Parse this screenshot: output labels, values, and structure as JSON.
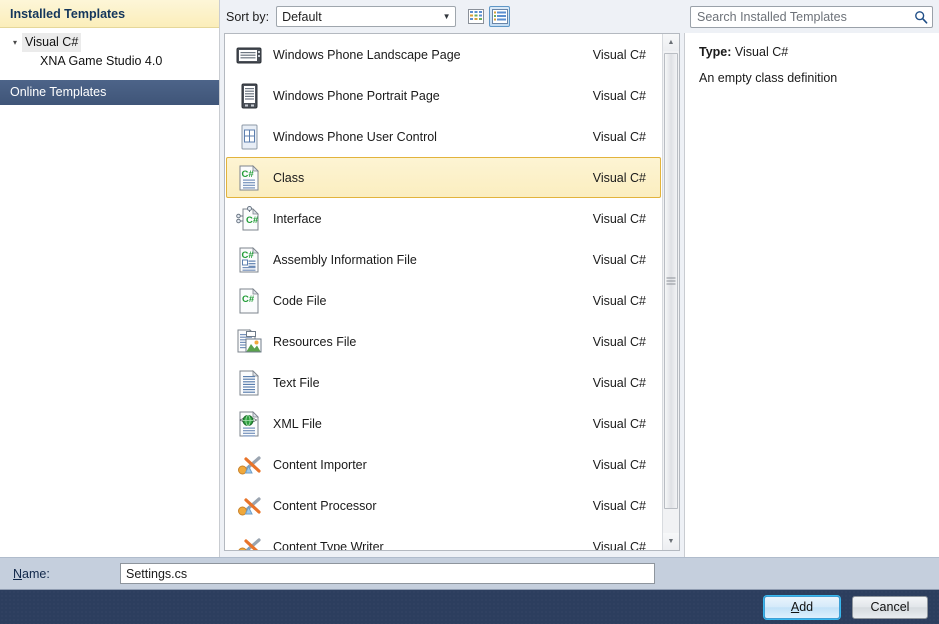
{
  "sidebar": {
    "header": "Installed Templates",
    "tree": {
      "root_label": "Visual C#",
      "child_label": "XNA Game Studio 4.0"
    },
    "online_label": "Online Templates"
  },
  "toolbar": {
    "sort_label": "Sort by:",
    "sort_value": "Default",
    "view_medium_icons": "medium-icons-view",
    "view_list": "list-view"
  },
  "search": {
    "placeholder": "Search Installed Templates",
    "value": ""
  },
  "details": {
    "type_label": "Type:",
    "type_value": "Visual C#",
    "description": "An empty class definition"
  },
  "templates": [
    {
      "name": "Windows Phone Landscape Page",
      "language": "Visual C#",
      "icon": "phone-landscape-icon",
      "selected": false
    },
    {
      "name": "Windows Phone Portrait Page",
      "language": "Visual C#",
      "icon": "phone-portrait-icon",
      "selected": false
    },
    {
      "name": "Windows Phone User Control",
      "language": "Visual C#",
      "icon": "phone-usercontrol-icon",
      "selected": false
    },
    {
      "name": "Class",
      "language": "Visual C#",
      "icon": "csharp-class-icon",
      "selected": true
    },
    {
      "name": "Interface",
      "language": "Visual C#",
      "icon": "csharp-interface-icon",
      "selected": false
    },
    {
      "name": "Assembly Information File",
      "language": "Visual C#",
      "icon": "csharp-assemblyinfo-icon",
      "selected": false
    },
    {
      "name": "Code File",
      "language": "Visual C#",
      "icon": "csharp-codefile-icon",
      "selected": false
    },
    {
      "name": "Resources File",
      "language": "Visual C#",
      "icon": "resources-file-icon",
      "selected": false
    },
    {
      "name": "Text File",
      "language": "Visual C#",
      "icon": "text-file-icon",
      "selected": false
    },
    {
      "name": "XML File",
      "language": "Visual C#",
      "icon": "xml-file-icon",
      "selected": false
    },
    {
      "name": "Content Importer",
      "language": "Visual C#",
      "icon": "content-pipeline-icon",
      "selected": false
    },
    {
      "name": "Content Processor",
      "language": "Visual C#",
      "icon": "content-pipeline-icon",
      "selected": false
    },
    {
      "name": "Content Type Writer",
      "language": "Visual C#",
      "icon": "content-pipeline-icon",
      "selected": false
    }
  ],
  "name_field": {
    "label_prefix": "N",
    "label_rest": "ame:",
    "value": "Settings.cs"
  },
  "buttons": {
    "add_accel": "A",
    "add_rest": "dd",
    "cancel": "Cancel"
  },
  "colors": {
    "selection_yellow": "#fbeec0",
    "selection_border": "#e2b33c",
    "sidebar_selected": "#4d6489",
    "bottom_bar": "#2c3e5e",
    "primary_focus": "#39b8ee"
  }
}
